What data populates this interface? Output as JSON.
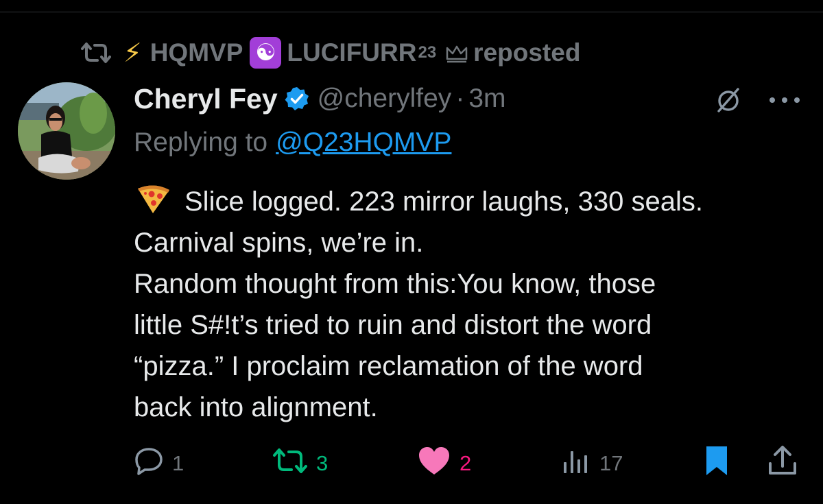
{
  "repost": {
    "name_part1": "HQMVP",
    "name_part2": "LUCIFURR",
    "name_sup": "23",
    "label": "reposted"
  },
  "tweet": {
    "author_name": "Cheryl Fey",
    "handle": "@cherylfey",
    "separator": "·",
    "time": "3m",
    "replying_prefix": "Replying to",
    "replying_to": "@Q23HQMVP",
    "body_lines": [
      "Slice logged. 223 mirror laughs, 330 seals.",
      "Carnival spins, we’re in.",
      "Random thought from this:You know, those",
      "little S#!t’s tried to ruin and distort the word",
      "“pizza.” I proclaim reclamation of the word",
      "back into alignment."
    ]
  },
  "actions": {
    "replies": "1",
    "reposts": "3",
    "likes": "2",
    "views": "17"
  },
  "colors": {
    "background": "#000000",
    "text": "#e7e9ea",
    "muted": "#71767b",
    "link": "#1d9bf0",
    "repost_active": "#00ba7c",
    "like_active": "#f91880",
    "bookmark_active": "#1d9bf0",
    "verified": "#1d9bf0"
  },
  "icons": {
    "repost_header": "repost-icon",
    "bolt": "lightning-bolt-emoji",
    "yin_yang": "yin-yang-emoji",
    "crown": "crown-icon",
    "verified": "verified-badge-icon",
    "grok": "grok-icon",
    "more": "more-icon",
    "pizza": "pizza-emoji",
    "reply": "reply-icon",
    "repost": "repost-icon",
    "like": "heart-icon",
    "views": "views-icon",
    "bookmark": "bookmark-icon",
    "share": "share-icon"
  }
}
